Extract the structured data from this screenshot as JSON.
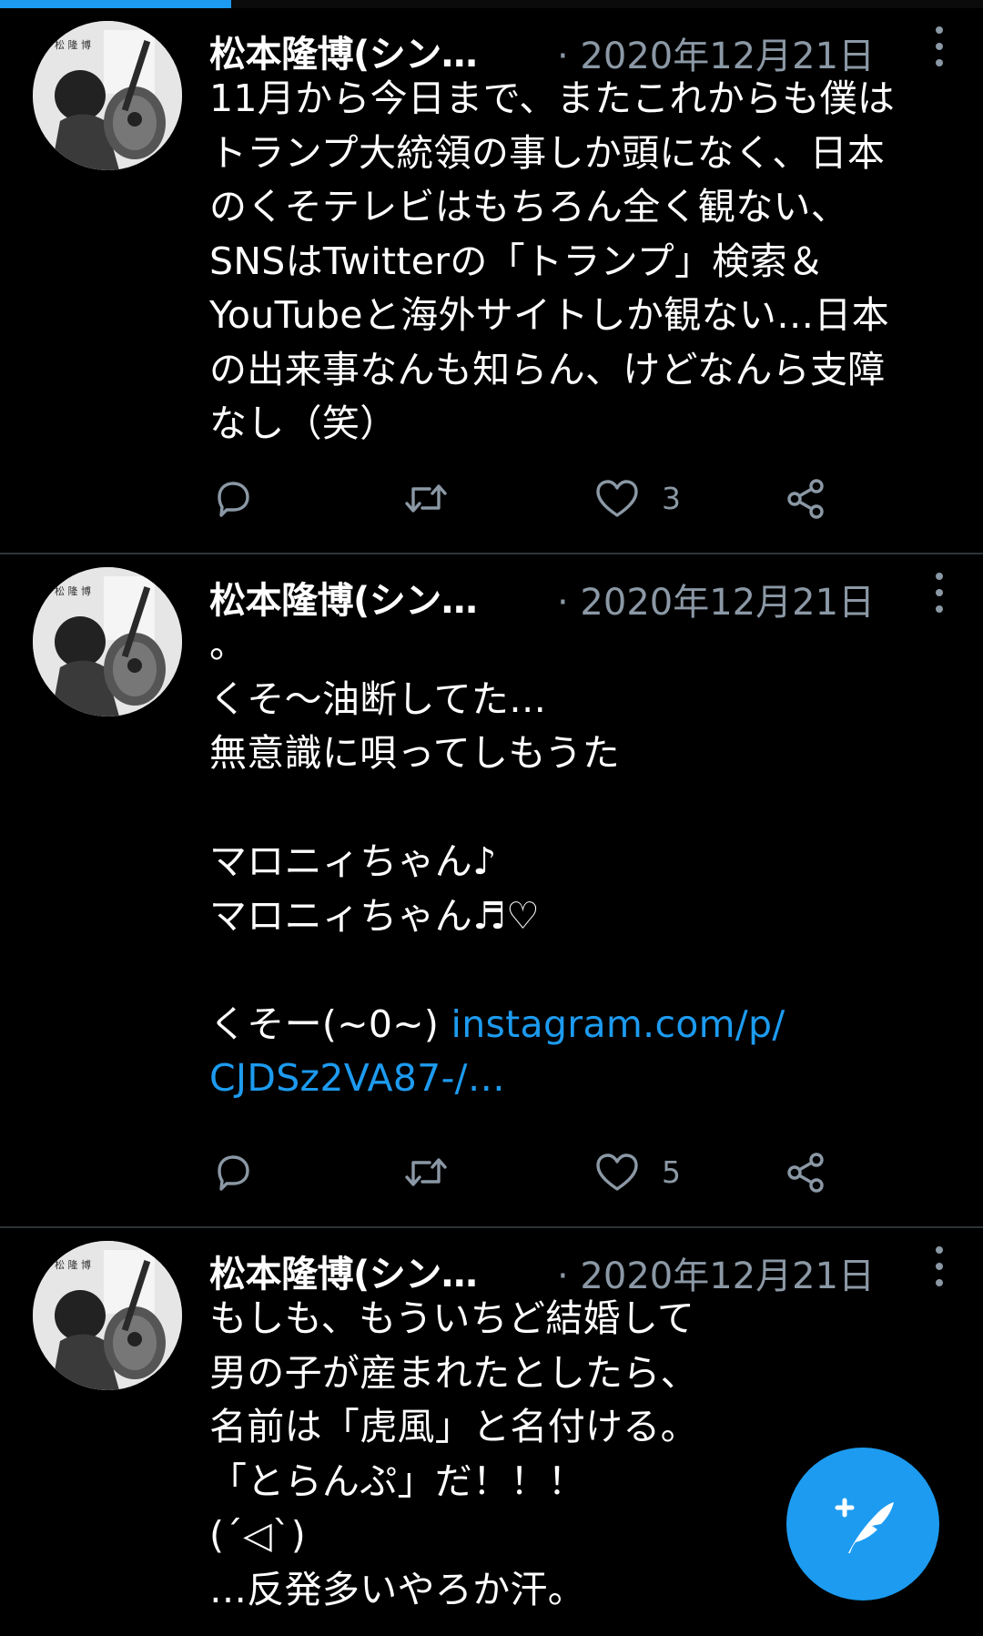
{
  "top_progress": {
    "fraction": 0.235,
    "color": "#1d9bf0"
  },
  "colors": {
    "background": "#000000",
    "text": "#ffffff",
    "muted": "#8b98a5",
    "link": "#1d9bf0",
    "divider": "#2f3336",
    "fab": "#1d9bf0"
  },
  "tweets": [
    {
      "author": "松本隆博(シン…",
      "date": "· 2020年12月21日",
      "lines": [
        "11月から今日まで、またこれからも僕は",
        "トランプ大統領の事しか頭になく、日本",
        "のくそテレビはもちろん全く観ない、",
        "SNSはTwitterの「トランプ」検索＆",
        "YouTubeと海外サイトしか観ない…日本",
        "の出来事なんも知らん、けどなんら支障",
        "なし（笑）"
      ],
      "like_count": "3"
    },
    {
      "author": "松本隆博(シン…",
      "date": "· 2020年12月21日",
      "lines": [
        "。",
        "くそ～油断してた…",
        "無意識に唄ってしもうた",
        "",
        "マロニィちゃん♪",
        "マロニィちゃん♬♡",
        "",
        "くそー(~0~) "
      ],
      "link_part1": "instagram.com/p/",
      "link_part2": "CJDSz2VA87-/…",
      "like_count": "5"
    },
    {
      "author": "松本隆博(シン…",
      "date": "· 2020年12月21日",
      "lines": [
        "もしも、もういちど結婚して",
        "男の子が産まれたとしたら、",
        "名前は「虎風」と名付ける。",
        "「とらんぷ」だ！！！",
        "(ˊ◁ˋ)",
        "…反発多いやろか汗。"
      ]
    }
  ],
  "icons": {
    "reply": "reply-icon",
    "retweet": "retweet-icon",
    "like": "heart-icon",
    "share": "share-icon",
    "more": "more-vertical-icon",
    "compose": "compose-tweet-icon"
  }
}
